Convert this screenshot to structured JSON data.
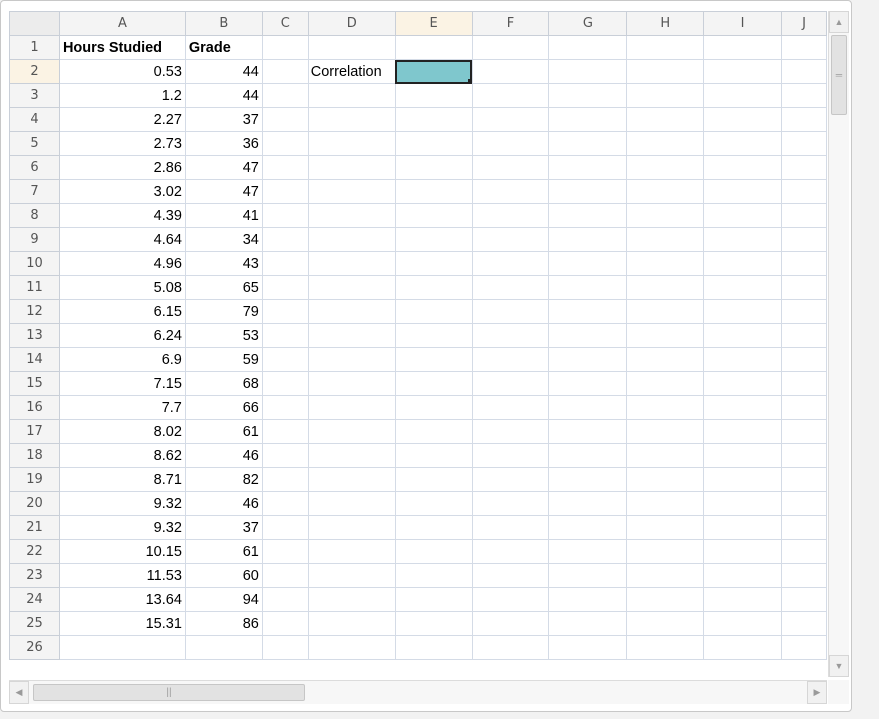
{
  "sheet": {
    "columns": [
      "A",
      "B",
      "C",
      "D",
      "E",
      "F",
      "G",
      "H",
      "I",
      "J"
    ],
    "active_column": "E",
    "active_row": 2,
    "header_row": {
      "A": "Hours Studied",
      "B": "Grade"
    },
    "label_cell": {
      "ref": "D2",
      "text": "Correlation"
    },
    "selected_cell": {
      "ref": "E2",
      "value": "",
      "fill_color": "#7fc7cd"
    },
    "rows": [
      {
        "n": "2",
        "a": "0.53",
        "b": "44"
      },
      {
        "n": "3",
        "a": "1.2",
        "b": "44"
      },
      {
        "n": "4",
        "a": "2.27",
        "b": "37"
      },
      {
        "n": "5",
        "a": "2.73",
        "b": "36"
      },
      {
        "n": "6",
        "a": "2.86",
        "b": "47"
      },
      {
        "n": "7",
        "a": "3.02",
        "b": "47"
      },
      {
        "n": "8",
        "a": "4.39",
        "b": "41"
      },
      {
        "n": "9",
        "a": "4.64",
        "b": "34"
      },
      {
        "n": "10",
        "a": "4.96",
        "b": "43"
      },
      {
        "n": "11",
        "a": "5.08",
        "b": "65"
      },
      {
        "n": "12",
        "a": "6.15",
        "b": "79"
      },
      {
        "n": "13",
        "a": "6.24",
        "b": "53"
      },
      {
        "n": "14",
        "a": "6.9",
        "b": "59"
      },
      {
        "n": "15",
        "a": "7.15",
        "b": "68"
      },
      {
        "n": "16",
        "a": "7.7",
        "b": "66"
      },
      {
        "n": "17",
        "a": "8.02",
        "b": "61"
      },
      {
        "n": "18",
        "a": "8.62",
        "b": "46"
      },
      {
        "n": "19",
        "a": "8.71",
        "b": "82"
      },
      {
        "n": "20",
        "a": "9.32",
        "b": "46"
      },
      {
        "n": "21",
        "a": "9.32",
        "b": "37"
      },
      {
        "n": "22",
        "a": "10.15",
        "b": "61"
      },
      {
        "n": "23",
        "a": "11.53",
        "b": "60"
      },
      {
        "n": "24",
        "a": "13.64",
        "b": "94"
      },
      {
        "n": "25",
        "a": "15.31",
        "b": "86"
      }
    ],
    "partial_row_number": "26"
  },
  "scrollbars": {
    "up_arrow": "▲",
    "down_arrow": "▼",
    "left_arrow": "◀",
    "right_arrow": "▶",
    "v_grip": "═",
    "h_grip": "||"
  },
  "colors": {
    "selection": "#7fc7cd",
    "header_bg": "#f4f4f4",
    "active_header_bg": "#fbf3e4",
    "gridline": "#d4dbe6"
  }
}
